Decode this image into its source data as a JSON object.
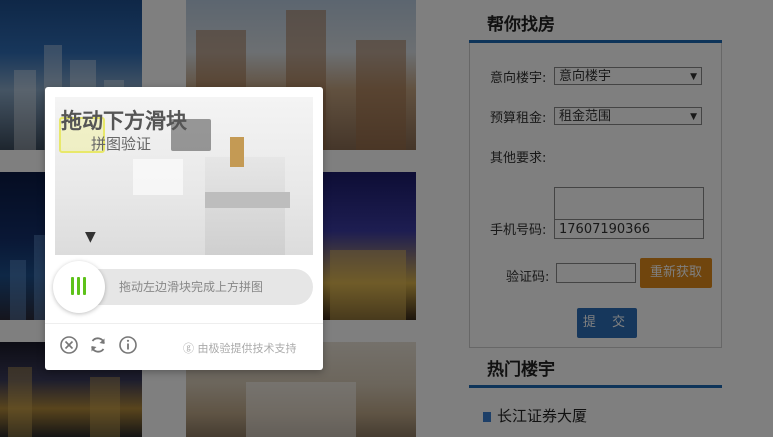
{
  "find_house": {
    "title": "帮你找房",
    "fields": {
      "building_label": "意向楼宇:",
      "building_value": "意向楼宇",
      "budget_label": "预算租金:",
      "budget_value": "租金范围",
      "other_label": "其他要求:",
      "phone_label": "手机号码:",
      "phone_value": "17607190366",
      "code_label": "验证码:",
      "code_value": ""
    },
    "refresh_button": "重新获取",
    "submit_button": "提 交"
  },
  "hot_buildings": {
    "title": "热门楼宇",
    "items": [
      "长江证券大厦"
    ]
  },
  "captcha": {
    "hint_title": "拖动下方滑块",
    "hint_subtitle": "拼图验证",
    "slider_text": "拖动左边滑块完成上方拼图",
    "credit": "由极验提供技术支持",
    "icons": {
      "close": "close-icon",
      "refresh": "refresh-icon",
      "info": "info-icon"
    },
    "accent_color": "#5ec21a"
  },
  "colors": {
    "panel_accent": "#1d68b2",
    "refresh_button": "#e08a1a",
    "submit_button": "#2c6fb8"
  }
}
